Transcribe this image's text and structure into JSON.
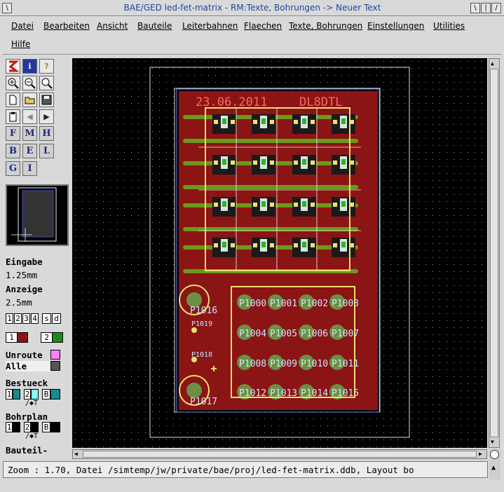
{
  "window": {
    "title": "BAE/GED led-fet-matrix - RM:Texte, Bohrungen -> Neuer Text",
    "buttons": [
      "\\",
      "|",
      "/"
    ]
  },
  "menu": [
    "Datei",
    "Bearbeiten",
    "Ansicht",
    "Bauteile",
    "Leiterbahnen",
    "Flaechen",
    "Texte, Bohrungen",
    "Einstellungen",
    "Utilities",
    "Hilfe"
  ],
  "toolbar": {
    "row1": [
      "shape-icon",
      "info-icon",
      "help-icon"
    ],
    "layer_buttons": [
      [
        "F",
        "M",
        "H"
      ],
      [
        "B",
        "E",
        "L"
      ],
      [
        "G",
        "I"
      ]
    ],
    "eingabe_label": "Eingabe",
    "eingabe_value": "1.25mm",
    "anzeige_label": "Anzeige",
    "anzeige_value": "2.5mm",
    "grid_options": [
      "1",
      "2",
      "3",
      "4",
      "s",
      "d"
    ],
    "layer1": "1",
    "layer2": "2",
    "unroute_label": "Unroute",
    "alle_label": "Alle",
    "bestueck_label": "Bestueck",
    "bestueck_opts": [
      "1",
      "2",
      "B"
    ],
    "bestueck_sub": "/◆T",
    "bohrplan_label": "Bohrplan",
    "bohrplan_opts": [
      "1",
      "2",
      "B"
    ],
    "bohrplan_sub": "/◆T",
    "bauteil_label": "Bauteil-"
  },
  "board": {
    "date_text": "23.06.2011",
    "author_text": "DL8DTL",
    "pad_labels": [
      "P1016",
      "P1019",
      "P1018",
      "P1017",
      "P1000",
      "P1001",
      "P1002",
      "P1003",
      "P1004",
      "P1005",
      "P1006",
      "P1007",
      "P1008",
      "P1009",
      "P1010",
      "P1011",
      "P1012",
      "P1013",
      "P1014",
      "P1015"
    ]
  },
  "status": {
    "text": "Zoom : 1.70, Datei /simtemp/jw/private/bae/proj/led-fet-matrix.ddb, Layout bo"
  },
  "colors": {
    "title": "#1a4aa0",
    "board_red": "#8b1414",
    "trace_green": "#6a9a1a",
    "outline_yellow": "#f0e070",
    "pad_label": "#c8e8ff"
  }
}
